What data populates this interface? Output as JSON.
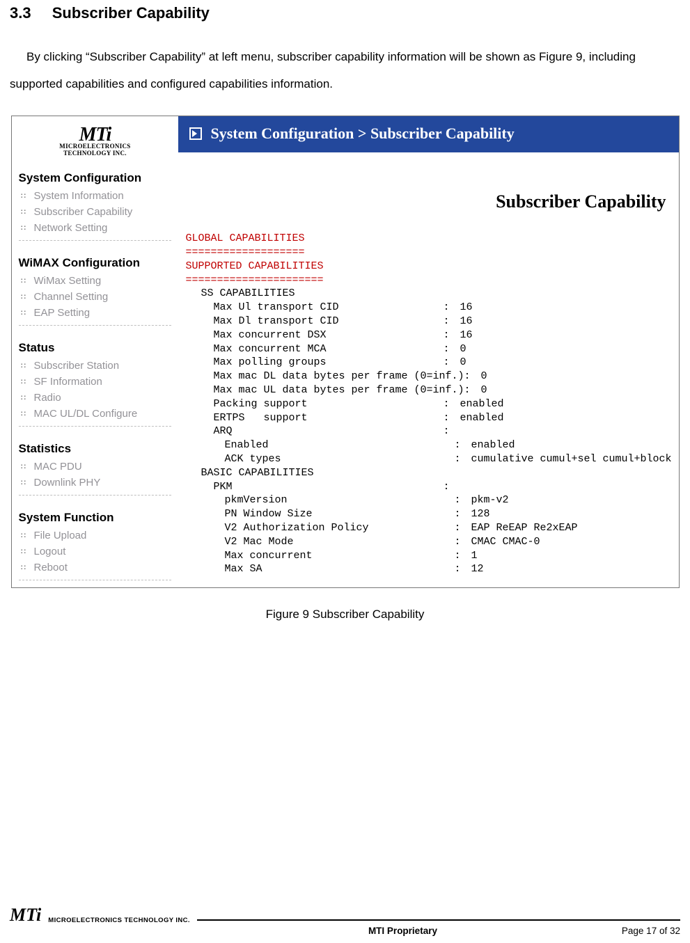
{
  "doc": {
    "section_number": "3.3",
    "section_title": "Subscriber Capability",
    "paragraph": "By clicking “Subscriber Capability” at left menu, subscriber capability information will be shown as Figure 9, including supported capabilities and configured capabilities information."
  },
  "sidebar": {
    "logo_line1": "MICROELECTRONICS",
    "logo_line2": "TECHNOLOGY INC.",
    "groups": [
      {
        "title": "System Configuration",
        "items": [
          "System Information",
          "Subscriber Capability",
          "Network Setting"
        ]
      },
      {
        "title": "WiMAX Configuration",
        "items": [
          "WiMax Setting",
          "Channel Setting",
          "EAP Setting"
        ]
      },
      {
        "title": "Status",
        "items": [
          "Subscriber Station",
          "SF Information",
          "Radio",
          "MAC UL/DL Configure"
        ]
      },
      {
        "title": "Statistics",
        "items": [
          "MAC PDU",
          "Downlink PHY"
        ]
      },
      {
        "title": "System Function",
        "items": [
          "File Upload",
          "Logout",
          "Reboot"
        ]
      }
    ]
  },
  "main": {
    "breadcrumb": "System Configuration > Subscriber Capability",
    "heading": "Subscriber Capability",
    "head_lines": [
      "GLOBAL CAPABILITIES",
      "===================",
      "SUPPORTED CAPABILITIES",
      "======================"
    ],
    "sect1": "SS CAPABILITIES",
    "kv1": [
      {
        "k": "Max Ul transport CID",
        "v": "16"
      },
      {
        "k": "Max Dl transport CID",
        "v": "16"
      },
      {
        "k": "Max concurrent DSX",
        "v": "16"
      },
      {
        "k": "Max concurrent MCA",
        "v": "0"
      },
      {
        "k": "Max polling groups",
        "v": "0"
      },
      {
        "k": "Max mac DL data bytes per frame (0=inf.)",
        "v": "0"
      },
      {
        "k": "Max mac UL data bytes per frame (0=inf.)",
        "v": "0"
      },
      {
        "k": "Packing support",
        "v": "enabled"
      },
      {
        "k": "ERTPS   support",
        "v": "enabled"
      }
    ],
    "arq_label": "ARQ",
    "arq_kv": [
      {
        "k": "Enabled",
        "v": "enabled"
      },
      {
        "k": "ACK types",
        "v": "cumulative cumul+sel cumul+block"
      }
    ],
    "sect2": "BASIC CAPABILITIES",
    "pkm_label": "PKM",
    "pkm_kv": [
      {
        "k": "pkmVersion",
        "v": "pkm-v2"
      },
      {
        "k": "PN Window Size",
        "v": "128"
      },
      {
        "k": "V2 Authorization Policy",
        "v": "EAP ReEAP Re2xEAP"
      },
      {
        "k": "V2 Mac Mode",
        "v": "CMAC CMAC-0"
      },
      {
        "k": "Max concurrent",
        "v": "1"
      },
      {
        "k": "Max SA",
        "v": "12"
      }
    ]
  },
  "caption": "Figure 9    Subscriber Capability",
  "footer": {
    "logo": "MTi",
    "logo_sub": "MICROELECTRONICS TECHNOLOGY INC.",
    "center": "MTI Proprietary",
    "right": "Page 17 of 32"
  }
}
